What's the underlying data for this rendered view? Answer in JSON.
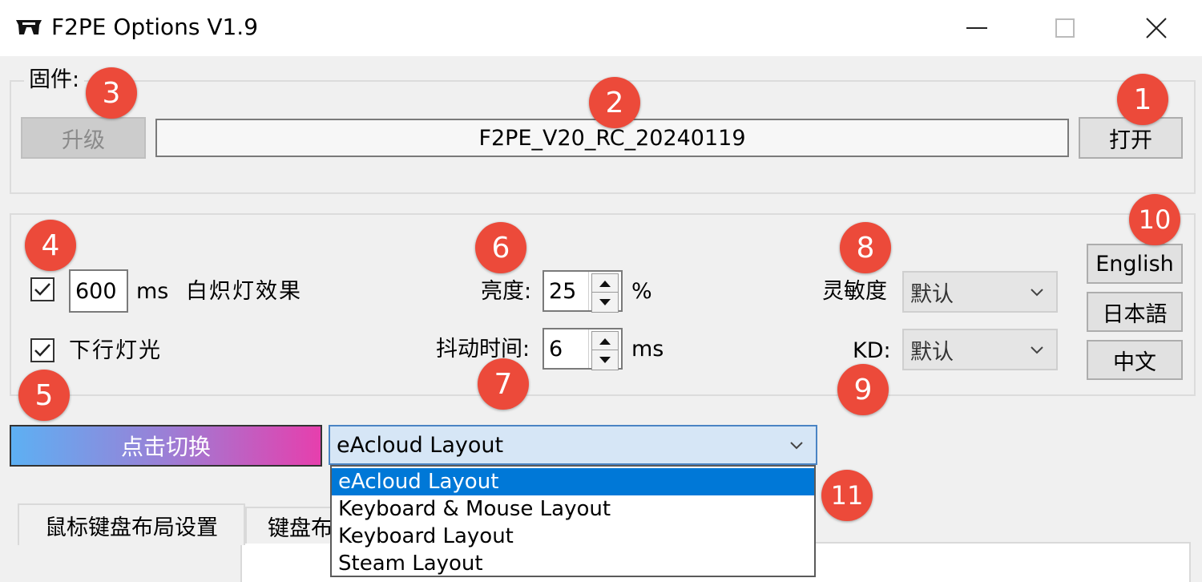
{
  "window": {
    "title": "F2PE Options V1.9"
  },
  "firmware": {
    "label": "固件:",
    "upgrade_label": "升级",
    "filename": "F2PE_V20_RC_20240119",
    "open_label": "打开"
  },
  "settings": {
    "incandescent": {
      "checked": true,
      "value": "600",
      "unit": "ms",
      "label": "白炽灯效果"
    },
    "downlight": {
      "checked": true,
      "label": "下行灯光"
    },
    "brightness": {
      "label": "亮度:",
      "value": "25",
      "unit": "%"
    },
    "debounce": {
      "label": "抖动时间:",
      "value": "6",
      "unit": "ms"
    },
    "sensitivity": {
      "label": "灵敏度",
      "value": "默认"
    },
    "kd": {
      "label": "KD:",
      "value": "默认"
    }
  },
  "languages": {
    "english": "English",
    "japanese": "日本語",
    "chinese": "中文"
  },
  "layout": {
    "switch_label": "点击切换",
    "selected": "eAcloud Layout",
    "options": [
      "eAcloud Layout",
      "Keyboard & Mouse Layout",
      "Keyboard Layout",
      "Steam Layout"
    ]
  },
  "tabs": [
    "鼠标键盘布局设置",
    "键盘布"
  ],
  "badges": [
    "1",
    "2",
    "3",
    "4",
    "5",
    "6",
    "7",
    "8",
    "9",
    "10",
    "11"
  ],
  "colors": {
    "badge": "#ec4a3a",
    "selection": "#0078d7"
  }
}
